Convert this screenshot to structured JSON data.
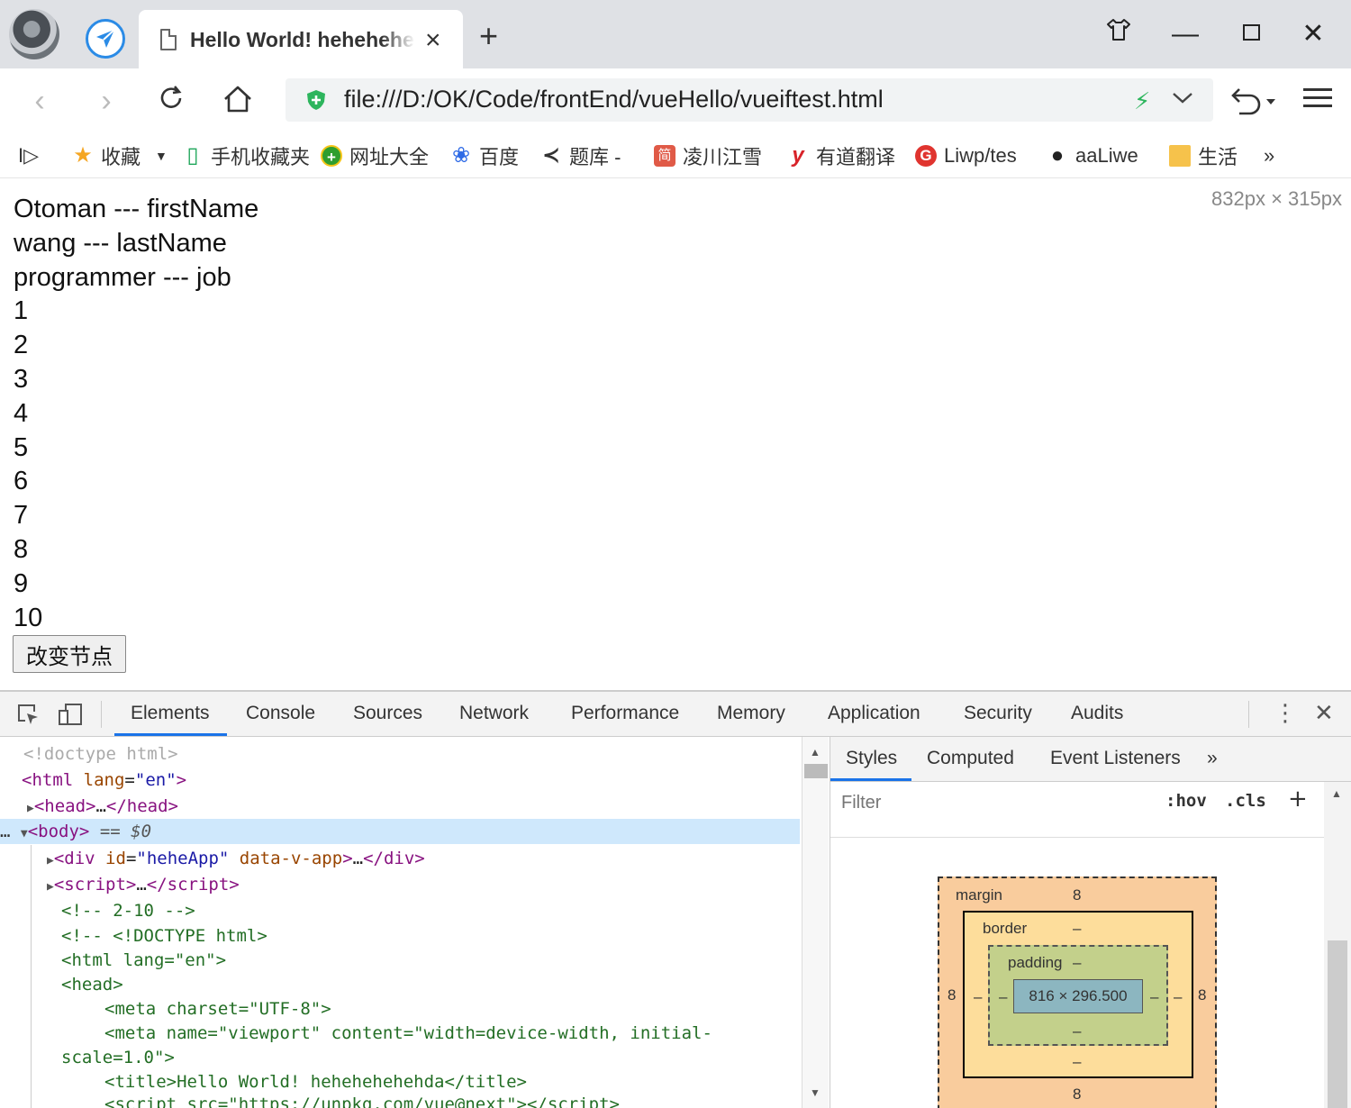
{
  "tab": {
    "title": "Hello World! hehehehe",
    "close": "×",
    "new_tab": "+"
  },
  "window_controls": {
    "skin": "👕",
    "minimize": "—",
    "maximize": "☐",
    "close": "✕"
  },
  "nav": {
    "back": "‹",
    "forward": "›",
    "reload": "↻",
    "home": "⌂"
  },
  "url": "file:///D:/OK/Code/frontEnd/vueHello/vueiftest.html",
  "bookmarks": {
    "toggle": "I▷",
    "items": [
      {
        "label": "收藏",
        "icon": "★",
        "color": "#f5a623"
      },
      {
        "label": "手机收藏夹",
        "icon": "▯",
        "color": "#1ea65a"
      },
      {
        "label": "网址大全",
        "icon": "+",
        "color": "#2f9e2f"
      },
      {
        "label": "百度",
        "icon": "❀",
        "color": "#2f6be6"
      },
      {
        "label": "题库 -",
        "icon": "≺",
        "color": "#333333"
      },
      {
        "label": "凌川江雪",
        "icon": "简",
        "color": "#e05a47"
      },
      {
        "label": "有道翻译",
        "icon": "y",
        "color": "#d8232a"
      },
      {
        "label": "Liwp/tes",
        "icon": "G",
        "color": "#e0342f"
      },
      {
        "label": "aaLiwe",
        "icon": "●",
        "color": "#222222"
      },
      {
        "label": "生活",
        "icon": "▭",
        "color": "#f6c24b"
      }
    ],
    "more": "»"
  },
  "page": {
    "lines": [
      "Otoman --- firstName",
      "wang --- lastName",
      "programmer --- job",
      "1",
      "2",
      "3",
      "4",
      "5",
      "6",
      "7",
      "8",
      "9",
      "10"
    ],
    "button": "改变节点",
    "dimensions": "832px × 315px"
  },
  "devtools": {
    "tabs": [
      "Elements",
      "Console",
      "Sources",
      "Network",
      "Performance",
      "Memory",
      "Application",
      "Security",
      "Audits"
    ],
    "active_tab": "Elements",
    "styles_tabs": [
      "Styles",
      "Computed",
      "Event Listeners"
    ],
    "styles_more": "»",
    "filter_placeholder": "Filter",
    "hov": ":hov",
    "cls": ".cls",
    "add": "+",
    "box_model": {
      "margin_label": "margin",
      "margin_top": "8",
      "margin_left": "8",
      "margin_right": "8",
      "margin_bottom": "8",
      "border_label": "border",
      "border_top": "–",
      "border_left": "–",
      "border_right": "–",
      "border_bottom": "–",
      "padding_label": "padding",
      "padding_top": "–",
      "padding_left": "–",
      "padding_right": "–",
      "padding_bottom": "–",
      "content": "816 × 296.500"
    }
  },
  "accent_color": "#1a73e8"
}
